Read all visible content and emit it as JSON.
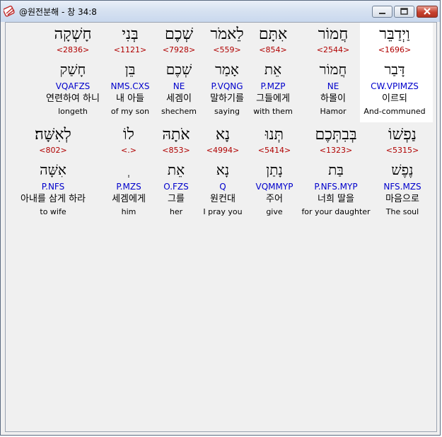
{
  "window": {
    "title": "@원전분해 - 창 34:8",
    "icons": {
      "app": "hebrew-app-icon",
      "minimize": "minimize-icon",
      "maximize": "maximize-icon",
      "close": "close-icon"
    }
  },
  "rows": [
    {
      "words": [
        {
          "hebrew": "וַיְדַבֵּר",
          "strong": "<1696>",
          "root": "דָּבַר",
          "morph": "CW.VPIMZS",
          "korean": "이르되",
          "english": "And-communed",
          "selected": true
        },
        {
          "hebrew": "חֲמוֹר",
          "strong": "<2544>",
          "root": "חֲמוֹר",
          "morph": "NE",
          "korean": "하몰이",
          "english": "Hamor"
        },
        {
          "hebrew": "אִתָּם",
          "strong": "<854>",
          "root": "אֵת",
          "morph": "P.MZP",
          "korean": "그들에게",
          "english": "with them"
        },
        {
          "hebrew": "לֵאמֹר",
          "strong": "<559>",
          "root": "אָמַר",
          "morph": "P.VQNG",
          "korean": "말하기를",
          "english": "saying"
        },
        {
          "hebrew": "שְׁכֶם",
          "strong": "<7928>",
          "root": "שְׁכֶם",
          "morph": "NE",
          "korean": "세겜이",
          "english": "shechem"
        },
        {
          "hebrew": "בְּנִי",
          "strong": "<1121>",
          "root": "בֵּן",
          "morph": "NMS.CXS",
          "korean": "내 아들",
          "english": "of my son"
        },
        {
          "hebrew": "חָשְׁקָה",
          "strong": "<2836>",
          "root": "חָשַׁק",
          "morph": "VQAFZS",
          "korean": "연련하여 하니",
          "english": "longeth"
        }
      ]
    },
    {
      "words": [
        {
          "hebrew": "נַפְשׁוֹ",
          "strong": "<5315>",
          "root": "נֶפֶשׁ",
          "morph": "NFS.MZS",
          "korean": "마음으로",
          "english": "The soul"
        },
        {
          "hebrew": "בְּבִתְּכֶם",
          "strong": "<1323>",
          "root": "בַּת",
          "morph": "P.NFS.MYP",
          "korean": "너희 딸을",
          "english": "for your daughter"
        },
        {
          "hebrew": "תְּנוּ",
          "strong": "<5414>",
          "root": "נָתַן",
          "morph": "VQMMYP",
          "korean": "주어",
          "english": "give"
        },
        {
          "hebrew": "נָא",
          "strong": "<4994>",
          "root": "נָא",
          "morph": "Q",
          "korean": "원컨대",
          "english": "I pray you"
        },
        {
          "hebrew": "אֹתָהּ",
          "strong": "<853>",
          "root": "אֵת",
          "morph": "O.FZS",
          "korean": "그를",
          "english": "her"
        },
        {
          "hebrew": "לוֹ",
          "strong": "<.>",
          "root": "ְ",
          "morph": "P.MZS",
          "korean": "세겜에게",
          "english": "him"
        },
        {
          "hebrew": "לְאִשָּׁה׃",
          "strong": "<802>",
          "root": "אִשָּׁה",
          "morph": "P.NFS",
          "korean": "아내를 삼게 하라",
          "english": "to wife"
        }
      ]
    }
  ]
}
